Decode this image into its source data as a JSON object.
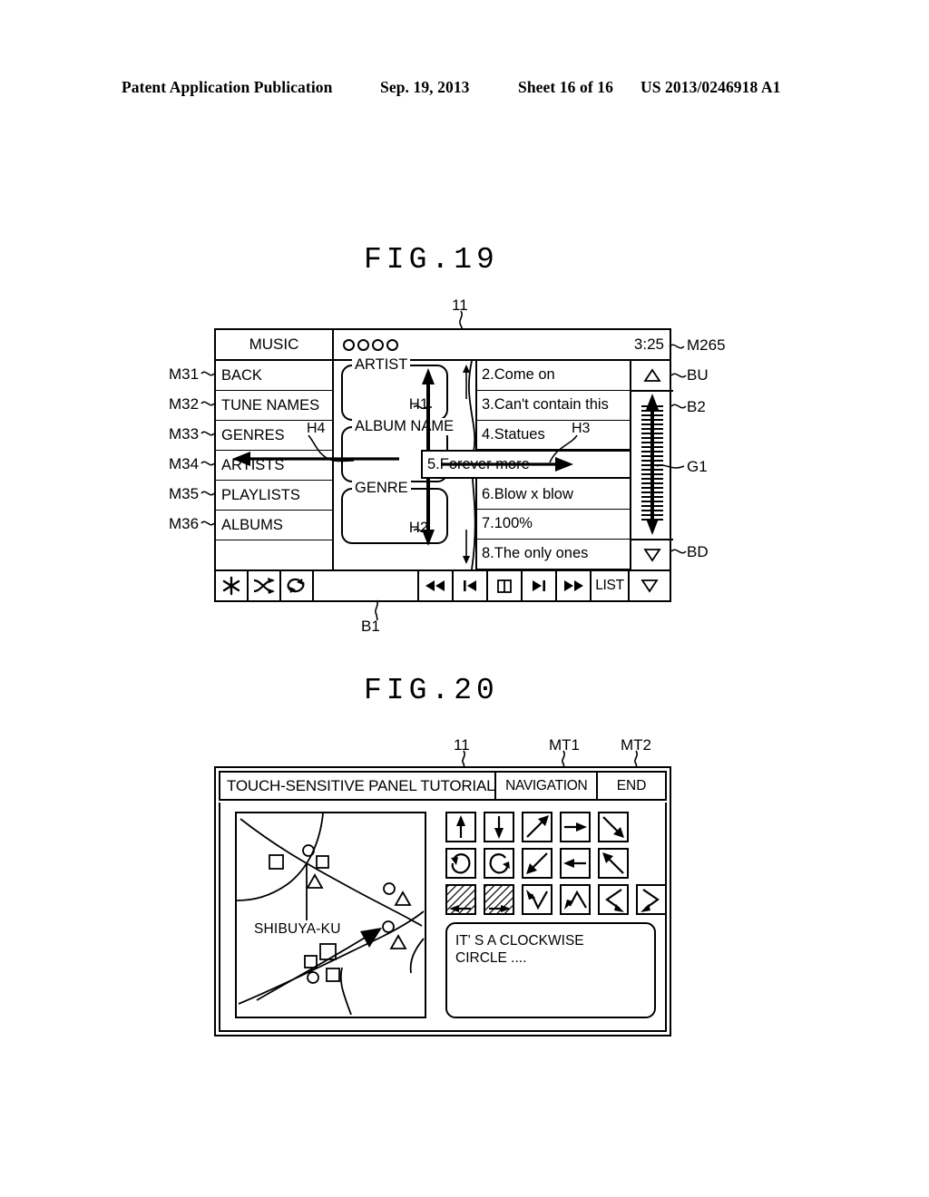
{
  "page_header": {
    "publication": "Patent Application Publication",
    "date": "Sep. 19, 2013",
    "sheet": "Sheet 16 of 16",
    "patent_number": "US 2013/0246918 A1"
  },
  "fig19": {
    "title": "FIG.19",
    "device_ref": "11",
    "bottom_ref": "B1",
    "topbar": {
      "source_label": "MUSIC",
      "track_dots": 4,
      "time": "3:25",
      "time_ref": "M265"
    },
    "menu": {
      "items": [
        {
          "ref": "M31",
          "label": "BACK"
        },
        {
          "ref": "M32",
          "label": "TUNE NAMES"
        },
        {
          "ref": "M33",
          "label": "GENRES"
        },
        {
          "ref": "M34",
          "label": "ARTISTS"
        },
        {
          "ref": "M35",
          "label": "PLAYLISTS"
        },
        {
          "ref": "M36",
          "label": "ALBUMS"
        }
      ],
      "hand_ref": "H4"
    },
    "center_boxes": [
      {
        "caption": "ARTIST",
        "hand_ref": "H1"
      },
      {
        "caption": "ALBUM NAME",
        "hand_ref": ""
      },
      {
        "caption": "GENRE",
        "hand_ref": "H2"
      }
    ],
    "tracks": {
      "items": [
        "2.Come on",
        "3.Can't contain this",
        "4.Statues",
        "5.Forever more",
        "6.Blow x blow",
        "7.100%",
        "8.The only ones"
      ],
      "highlighted_index": 3,
      "hand_ref": "H3"
    },
    "scrollbar": {
      "up_ref": "BU",
      "up_icon": "triangle-up-icon",
      "down_ref": "BD",
      "down_icon": "triangle-down-icon",
      "bar_ref": "B2",
      "gauge_ref": "G1"
    },
    "toolbar": {
      "icons": [
        "snowflake-icon",
        "shuffle-icon",
        "repeat-icon"
      ],
      "controls": [
        "rewind-icon",
        "previous-track-icon",
        "pause-icon",
        "next-track-icon",
        "fast-forward-icon"
      ],
      "list_label": "LIST",
      "more_icon": "triangle-down-icon"
    }
  },
  "fig20": {
    "title": "FIG.20",
    "device_ref": "11",
    "topbar": {
      "title": "TOUCH-SENSITIVE PANEL TUTORIAL",
      "nav_button": "NAVIGATION",
      "nav_ref": "MT1",
      "end_button": "END",
      "end_ref": "MT2"
    },
    "map": {
      "label": "SHIBUYA-KU"
    },
    "gestures": {
      "row1": [
        "arrow-up-icon",
        "arrow-down-icon",
        "arrow-up-right-icon",
        "arrow-right-icon",
        "arrow-down-right-icon"
      ],
      "row2": [
        "circle-counterclockwise-icon",
        "circle-clockwise-icon",
        "arrow-down-left-icon",
        "arrow-left-icon",
        "arrow-up-left-icon"
      ],
      "row3": [
        "hatched-swipe-left-icon",
        "hatched-swipe-right-icon",
        "v-shape-icon",
        "caret-shape-icon",
        "left-chevron-icon",
        "right-chevron-icon"
      ]
    },
    "message": "IT' S A CLOCKWISE\nCIRCLE ...."
  }
}
